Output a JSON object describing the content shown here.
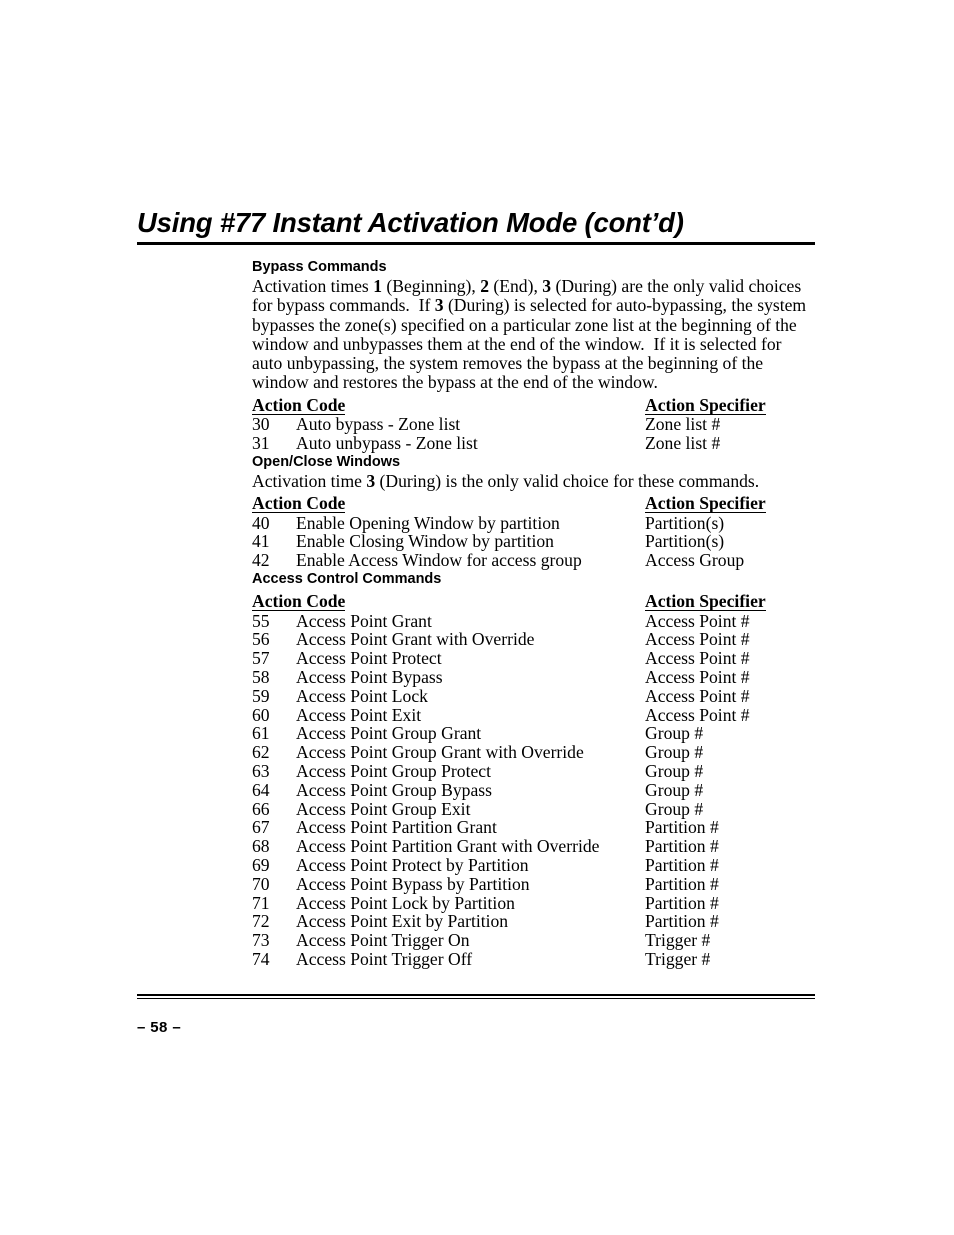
{
  "document": {
    "title": "Using #77 Instant Activation Mode (cont’d)",
    "page_number": "– 58 –"
  },
  "sections": [
    {
      "heading": "Bypass Commands",
      "intro_html": "Activation times <b>1</b> (Beginning), <b>2</b> (End), <b>3</b> (During) are the only valid choices for bypass commands.&nbsp; If <b>3</b> (During) is selected for auto-bypassing, the system bypasses the zone(s) specified on a particular zone list at the beginning of the window and unbypasses them at the end of the window.&nbsp; If it is selected for auto unbypassing, the system removes the bypass at the beginning of the window and restores the bypass at the end of the window.",
      "columns": {
        "code": "Action Code",
        "specifier": "Action Specifier"
      },
      "rows": [
        {
          "code": "30",
          "description": "Auto bypass - Zone list",
          "specifier": "Zone list #"
        },
        {
          "code": "31",
          "description": "Auto unbypass - Zone list",
          "specifier": "Zone list #"
        }
      ]
    },
    {
      "heading": "Open/Close Windows",
      "intro_html": "Activation time <b>3</b> (During) is the only valid choice for these commands.",
      "columns": {
        "code": "Action Code",
        "specifier": "Action Specifier"
      },
      "rows": [
        {
          "code": "40",
          "description": "Enable Opening Window by partition",
          "specifier": "Partition(s)"
        },
        {
          "code": "41",
          "description": "Enable Closing Window by partition",
          "specifier": "Partition(s)"
        },
        {
          "code": "42",
          "description": "Enable Access Window for access group",
          "specifier": "Access Group"
        }
      ]
    },
    {
      "heading": "Access Control Commands",
      "intro_html": "",
      "columns": {
        "code": "Action Code",
        "specifier": "Action Specifier"
      },
      "rows": [
        {
          "code": "55",
          "description": "Access Point Grant",
          "specifier": "Access Point #"
        },
        {
          "code": "56",
          "description": "Access Point Grant with Override",
          "specifier": "Access Point #"
        },
        {
          "code": "57",
          "description": "Access Point Protect",
          "specifier": "Access Point #"
        },
        {
          "code": "58",
          "description": "Access Point Bypass",
          "specifier": "Access Point #"
        },
        {
          "code": "59",
          "description": "Access Point Lock",
          "specifier": "Access Point #"
        },
        {
          "code": "60",
          "description": "Access Point Exit",
          "specifier": "Access Point #"
        },
        {
          "code": "61",
          "description": "Access Point Group Grant",
          "specifier": "Group #"
        },
        {
          "code": "62",
          "description": "Access Point Group Grant with Override",
          "specifier": "Group #"
        },
        {
          "code": "63",
          "description": "Access Point Group Protect",
          "specifier": "Group #"
        },
        {
          "code": "64",
          "description": "Access Point Group Bypass",
          "specifier": "Group #"
        },
        {
          "code": "66",
          "description": "Access Point Group Exit",
          "specifier": "Group #"
        },
        {
          "code": "67",
          "description": "Access Point Partition Grant",
          "specifier": "Partition #"
        },
        {
          "code": "68",
          "description": "Access Point Partition Grant with Override",
          "specifier": "Partition #"
        },
        {
          "code": "69",
          "description": "Access Point Protect by Partition",
          "specifier": "Partition #"
        },
        {
          "code": "70",
          "description": "Access Point Bypass by Partition",
          "specifier": "Partition #"
        },
        {
          "code": "71",
          "description": "Access Point Lock by Partition",
          "specifier": "Partition #"
        },
        {
          "code": "72",
          "description": "Access Point Exit by Partition",
          "specifier": "Partition #"
        },
        {
          "code": "73",
          "description": "Access Point Trigger On",
          "specifier": "Trigger #"
        },
        {
          "code": "74",
          "description": "Access Point Trigger Off",
          "specifier": "Trigger #"
        }
      ]
    }
  ]
}
